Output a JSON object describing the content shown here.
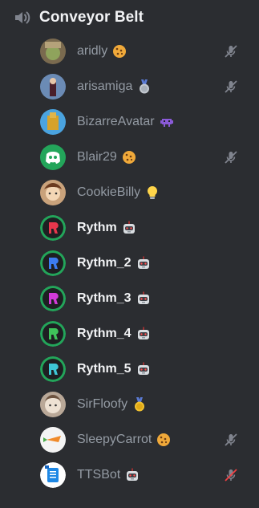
{
  "channel": {
    "title": "Conveyor Belt",
    "icon": "speaker-icon"
  },
  "colors": {
    "background": "#2b2d31",
    "member_name": "#949ba4",
    "bot_name": "#f2f3f5",
    "mute_icon": "#80848e",
    "server_mute_icon": "#f23f43"
  },
  "members": [
    {
      "name": "aridly",
      "badge": "cookie-icon",
      "muted": true,
      "bot": false
    },
    {
      "name": "arisamiga",
      "badge": "silver-medal-icon",
      "muted": true,
      "bot": false
    },
    {
      "name": "BizarreAvatar",
      "badge": "purple-invader-icon",
      "muted": false,
      "bot": false
    },
    {
      "name": "Blair29",
      "badge": "cookie-icon",
      "muted": true,
      "bot": false
    },
    {
      "name": "CookieBilly",
      "badge": "lightbulb-icon",
      "muted": false,
      "bot": false
    },
    {
      "name": "Rythm",
      "badge": "robot-icon",
      "muted": false,
      "bot": true
    },
    {
      "name": "Rythm_2",
      "badge": "robot-icon",
      "muted": false,
      "bot": true
    },
    {
      "name": "Rythm_3",
      "badge": "robot-icon",
      "muted": false,
      "bot": true
    },
    {
      "name": "Rythm_4",
      "badge": "robot-icon",
      "muted": false,
      "bot": true
    },
    {
      "name": "Rythm_5",
      "badge": "robot-icon",
      "muted": false,
      "bot": true
    },
    {
      "name": "SirFloofy",
      "badge": "gold-medal-icon",
      "muted": false,
      "bot": false
    },
    {
      "name": "SleepyCarrot",
      "badge": "cookie-icon",
      "muted": true,
      "bot": false
    },
    {
      "name": "TTSBot",
      "badge": "robot-icon",
      "muted": true,
      "server_muted": true,
      "bot": false
    }
  ]
}
